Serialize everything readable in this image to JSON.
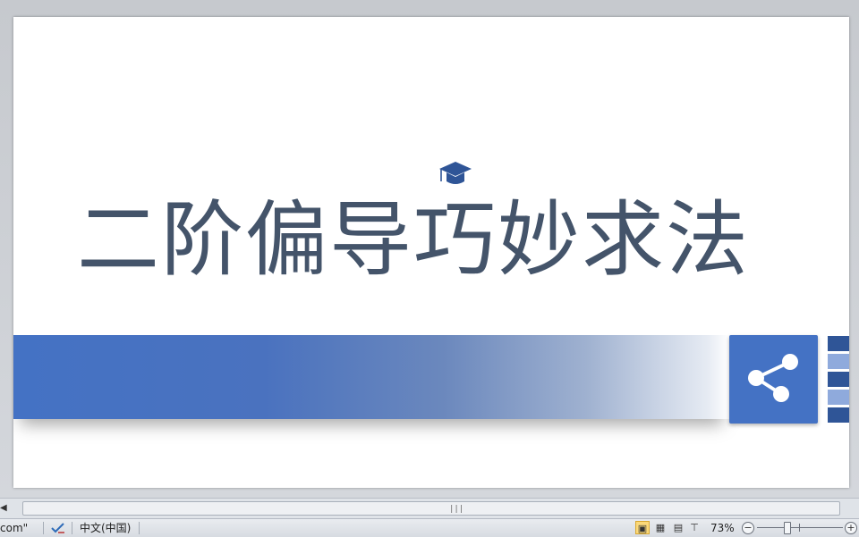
{
  "slide": {
    "title": "二阶偏导巧妙求法",
    "icons": {
      "title_decoration": "graduation-cap-icon",
      "share": "share-icon"
    },
    "colors": {
      "title": "#44546a",
      "accent": "#4472c4",
      "accent_dark": "#2f5597",
      "accent_light": "#8faadc"
    }
  },
  "statusbar": {
    "left_fragment": "com\"",
    "language": "中文(中国)",
    "zoom_label": "73%",
    "zoom_minus": "−",
    "zoom_plus": "+"
  },
  "scrollbar": {
    "grip": "|||"
  }
}
